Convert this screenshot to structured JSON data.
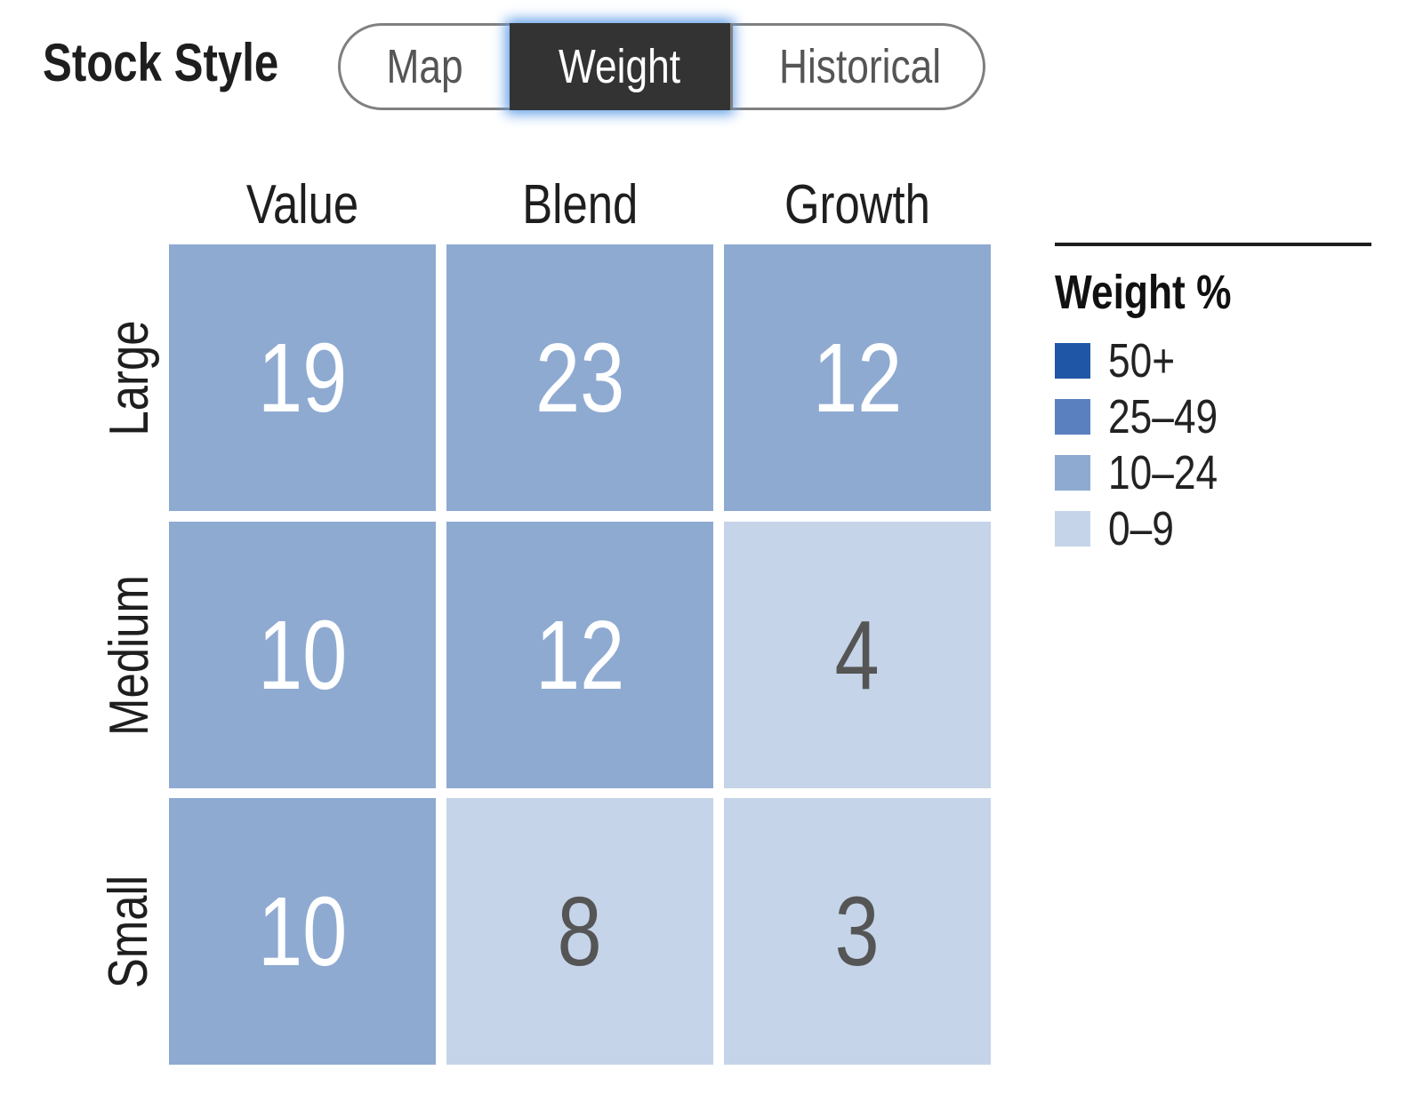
{
  "title": "Stock Style",
  "toggle": {
    "tabs": [
      "Map",
      "Weight",
      "Historical"
    ],
    "selected": "Weight"
  },
  "chart_data": {
    "type": "heatmap",
    "columns": [
      "Value",
      "Blend",
      "Growth"
    ],
    "rows": [
      "Large",
      "Medium",
      "Small"
    ],
    "values": [
      [
        19,
        23,
        12
      ],
      [
        10,
        12,
        4
      ],
      [
        10,
        8,
        3
      ]
    ],
    "legend": {
      "title": "Weight %",
      "placement": "right",
      "bins": [
        {
          "label": "50+",
          "min": 50,
          "color": "#1f56a5"
        },
        {
          "label": "25–49",
          "min": 25,
          "color": "#5a80bf"
        },
        {
          "label": "10–24",
          "min": 10,
          "color": "#8eaad1"
        },
        {
          "label": "0–9",
          "min": 0,
          "color": "#c5d4e8"
        }
      ]
    }
  }
}
